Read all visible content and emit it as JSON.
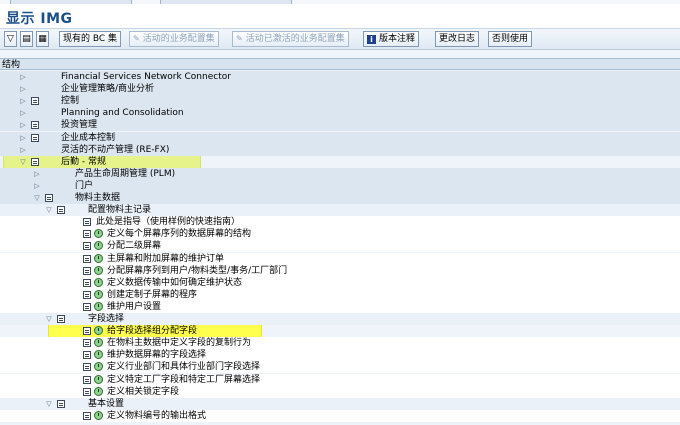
{
  "title": "显示 IMG",
  "toolbar": {
    "buttons": [
      {
        "label": "现有的 BC 集",
        "enabled": true
      },
      {
        "label": "活动的业务配置集",
        "enabled": false
      },
      {
        "label": "活动已激活的业务配置集",
        "enabled": false
      },
      {
        "label": "版本注释",
        "enabled": true
      },
      {
        "label": "更改日志",
        "enabled": true
      },
      {
        "label": "否则使用",
        "enabled": true
      }
    ]
  },
  "tree_header": "结构",
  "tree": [
    {
      "label": "Financial Services Network Connector",
      "level": 0,
      "doc": false,
      "clock": false,
      "expanded": false
    },
    {
      "label": "企业管理策略/商业分析",
      "level": 0,
      "doc": false,
      "clock": false,
      "expanded": false
    },
    {
      "label": "控制",
      "level": 0,
      "doc": true,
      "clock": false,
      "expanded": false
    },
    {
      "label": "Planning and Consolidation",
      "level": 0,
      "doc": false,
      "clock": false,
      "expanded": false
    },
    {
      "label": "投资管理",
      "level": 0,
      "doc": true,
      "clock": false,
      "expanded": false
    },
    {
      "label": "企业成本控制",
      "level": 0,
      "doc": true,
      "clock": false,
      "expanded": false
    },
    {
      "label": "灵活的不动产管理 (RE-FX)",
      "level": 0,
      "doc": false,
      "clock": false,
      "expanded": false
    },
    {
      "label": "后勤 - 常规",
      "level": 0,
      "doc": true,
      "clock": false,
      "expanded": true,
      "highlight": "green"
    },
    {
      "label": "产品生命周期管理 (PLM)",
      "level": 1,
      "doc": false,
      "clock": false,
      "expanded": false
    },
    {
      "label": "门户",
      "level": 1,
      "doc": false,
      "clock": false,
      "expanded": false
    },
    {
      "label": "物料主数据",
      "level": 1,
      "doc": true,
      "clock": false,
      "expanded": true
    },
    {
      "label": "配置物料主记录",
      "level": 2,
      "doc": true,
      "clock": false,
      "expanded": true
    },
    {
      "label": "此处是指导（使用样例的快速指南）",
      "level": 3,
      "doc": true,
      "clock": false,
      "leaf": true
    },
    {
      "label": "定义每个屏幕序列的数据屏幕的结构",
      "level": 3,
      "doc": true,
      "clock": true,
      "leaf": true
    },
    {
      "label": "分配二级屏幕",
      "level": 3,
      "doc": true,
      "clock": true,
      "leaf": true
    },
    {
      "label": "主屏幕和附加屏幕的维护订单",
      "level": 3,
      "doc": true,
      "clock": true,
      "leaf": true
    },
    {
      "label": "分配屏幕序列到用户/物料类型/事务/工厂部门",
      "level": 3,
      "doc": true,
      "clock": true,
      "leaf": true
    },
    {
      "label": "定义数据传输中如何确定维护状态",
      "level": 3,
      "doc": true,
      "clock": true,
      "leaf": true
    },
    {
      "label": "创建定制子屏幕的程序",
      "level": 3,
      "doc": true,
      "clock": true,
      "leaf": true
    },
    {
      "label": "维护用户设置",
      "level": 3,
      "doc": true,
      "clock": true,
      "leaf": true
    },
    {
      "label": "字段选择",
      "level": 2,
      "doc": true,
      "clock": false,
      "expanded": true
    },
    {
      "label": "给字段选择组分配字段",
      "level": 3,
      "doc": true,
      "clock": true,
      "leaf": true,
      "highlight": "yellow"
    },
    {
      "label": "在物料主数据中定义字段的复制行为",
      "level": 3,
      "doc": true,
      "clock": true,
      "leaf": true
    },
    {
      "label": "维护数据屏幕的字段选择",
      "level": 3,
      "doc": true,
      "clock": true,
      "leaf": true
    },
    {
      "label": "定义行业部门和具体行业部门字段选择",
      "level": 3,
      "doc": true,
      "clock": true,
      "leaf": true
    },
    {
      "label": "定义特定工厂字段和特定工厂屏幕选择",
      "level": 3,
      "doc": true,
      "clock": true,
      "leaf": true
    },
    {
      "label": "定义相关锁定字段",
      "level": 3,
      "doc": true,
      "clock": true,
      "leaf": true
    },
    {
      "label": "基本设置",
      "level": 2,
      "doc": true,
      "clock": false,
      "expanded": true
    },
    {
      "label": "定义物料编号的输出格式",
      "level": 3,
      "doc": true,
      "clock": true,
      "leaf": true
    }
  ]
}
